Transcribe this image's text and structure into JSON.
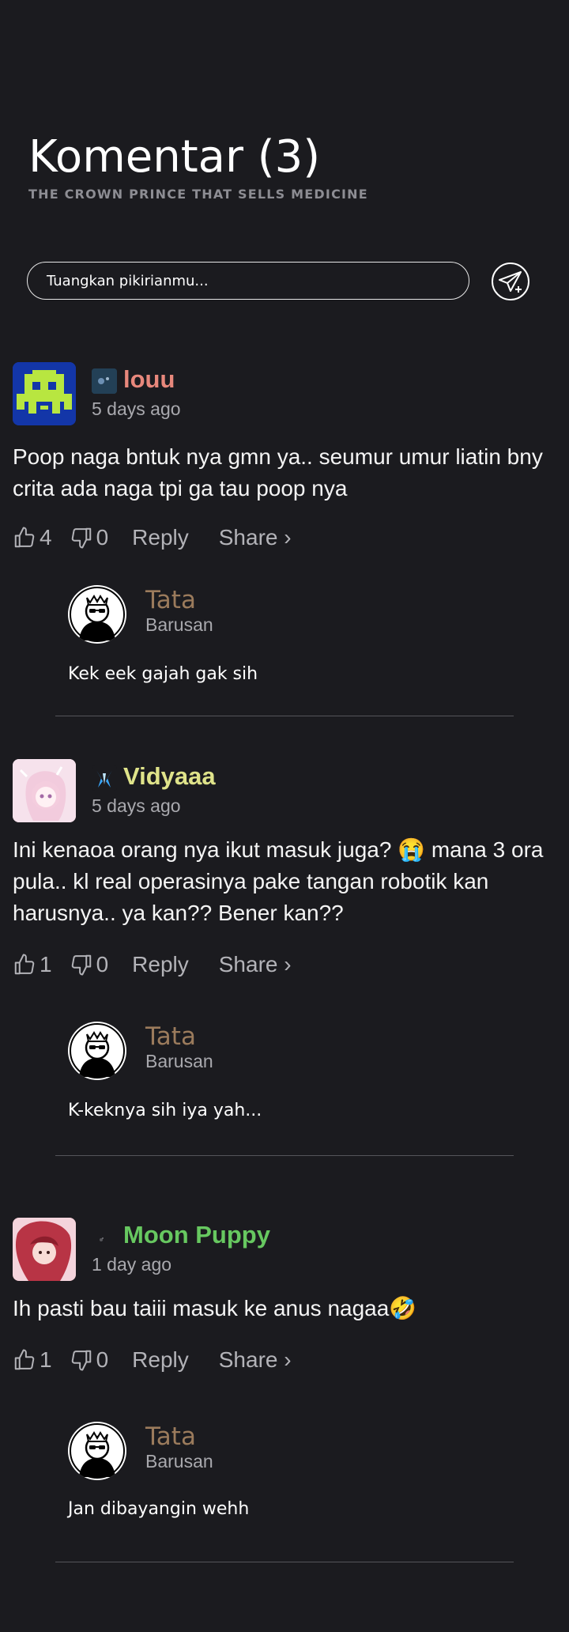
{
  "header": {
    "title": "Komentar (3)",
    "subtitle": "THE CROWN PRINCE THAT SELLS MEDICINE"
  },
  "compose": {
    "placeholder": "Tuangkan pikirianmu...",
    "send_icon": "send-icon"
  },
  "comments": [
    {
      "username": "louu",
      "username_color": "#e8887c",
      "time": "5 days ago",
      "text_lines": [
        "Poop naga bntuk nya gmn ya.. seumur umur liatin bny",
        "crita ada naga tpi ga tau poop nya"
      ],
      "likes": "4",
      "dislikes": "0",
      "reply_label": "Reply",
      "share_label": "Share ›",
      "reply": {
        "username": "Tata",
        "time": "Barusan",
        "text": "Kek eek gajah gak sih"
      }
    },
    {
      "username": "Vidyaaa",
      "username_color": "#dfe38a",
      "time": "5 days ago",
      "text_lines": [
        "Ini kenaoa orang nya ikut masuk juga? 😭 mana 3 ora",
        "pula.. kl real operasinya pake tangan robotik kan",
        "harusnya.. ya kan?? Bener kan??"
      ],
      "likes": "1",
      "dislikes": "0",
      "reply_label": "Reply",
      "share_label": "Share ›",
      "reply": {
        "username": "Tata",
        "time": "Barusan",
        "text": "K-keknya sih iya yah..."
      }
    },
    {
      "username": "Moon Puppy",
      "username_color": "#67c860",
      "time": "1 day ago",
      "text_lines": [
        "Ih pasti bau taiii masuk ke anus nagaa🤣"
      ],
      "likes": "1",
      "dislikes": "0",
      "reply_label": "Reply",
      "share_label": "Share ›",
      "reply": {
        "username": "Tata",
        "time": "Barusan",
        "text": "Jan dibayangin wehh"
      }
    }
  ]
}
